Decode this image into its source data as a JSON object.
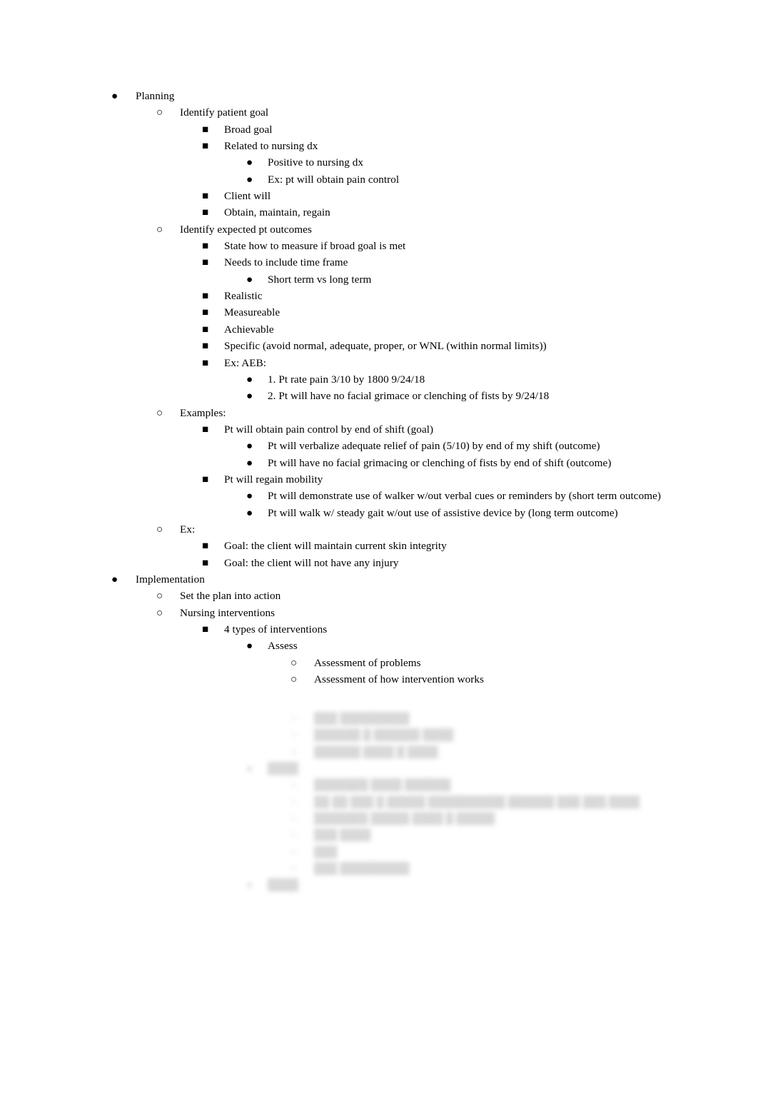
{
  "document": {
    "background_color": "#ffffff",
    "text_color": "#000000",
    "markers": {
      "disc": "●",
      "circle": "○",
      "square": "■"
    },
    "outline": [
      {
        "level": 1,
        "marker": "disc",
        "text": "Planning"
      },
      {
        "level": 2,
        "marker": "circle",
        "text": "Identify patient goal"
      },
      {
        "level": 3,
        "marker": "square",
        "text": "Broad goal"
      },
      {
        "level": 3,
        "marker": "square",
        "text": "Related to nursing dx"
      },
      {
        "level": 4,
        "marker": "disc",
        "text": "Positive to nursing dx"
      },
      {
        "level": 4,
        "marker": "disc",
        "text": "Ex: pt will obtain pain control"
      },
      {
        "level": 3,
        "marker": "square",
        "text": "Client will"
      },
      {
        "level": 3,
        "marker": "square",
        "text": "Obtain, maintain, regain"
      },
      {
        "level": 2,
        "marker": "circle",
        "text": "Identify expected pt outcomes"
      },
      {
        "level": 3,
        "marker": "square",
        "text": "State how to measure if broad goal is met"
      },
      {
        "level": 3,
        "marker": "square",
        "text": "Needs to include time frame"
      },
      {
        "level": 4,
        "marker": "disc",
        "text": "Short term vs long term"
      },
      {
        "level": 3,
        "marker": "square",
        "text": "Realistic"
      },
      {
        "level": 3,
        "marker": "square",
        "text": "Measureable"
      },
      {
        "level": 3,
        "marker": "square",
        "text": "Achievable"
      },
      {
        "level": 3,
        "marker": "square",
        "text": "Specific (avoid normal, adequate, proper, or WNL (within normal limits))"
      },
      {
        "level": 3,
        "marker": "square",
        "text": "Ex: AEB:"
      },
      {
        "level": 4,
        "marker": "disc",
        "text": "1. Pt rate pain 3/10 by 1800 9/24/18"
      },
      {
        "level": 4,
        "marker": "disc",
        "text": "2. Pt will have no facial grimace or clenching of fists by 9/24/18"
      },
      {
        "level": 2,
        "marker": "circle",
        "text": "Examples:"
      },
      {
        "level": 3,
        "marker": "square",
        "text": "Pt will obtain pain control by end of shift (goal)"
      },
      {
        "level": 4,
        "marker": "disc",
        "text": "Pt will verbalize adequate relief of pain (5/10) by end of my shift (outcome)"
      },
      {
        "level": 4,
        "marker": "disc",
        "text": "Pt will have no facial grimacing or clenching of fists by end of shift (outcome)"
      },
      {
        "level": 3,
        "marker": "square",
        "text": "Pt will regain mobility"
      },
      {
        "level": 4,
        "marker": "disc",
        "text": "Pt will demonstrate use of walker w/out verbal cues or reminders by (short term outcome)"
      },
      {
        "level": 4,
        "marker": "disc",
        "text": "Pt will walk w/ steady gait w/out use of assistive device by (long term outcome)"
      },
      {
        "level": 2,
        "marker": "circle",
        "text": "Ex:"
      },
      {
        "level": 3,
        "marker": "square",
        "text": "Goal: the client will maintain current skin integrity"
      },
      {
        "level": 3,
        "marker": "square",
        "text": "Goal: the client will not have any injury"
      },
      {
        "level": 1,
        "marker": "disc",
        "text": "Implementation"
      },
      {
        "level": 2,
        "marker": "circle",
        "text": "Set the plan into action"
      },
      {
        "level": 2,
        "marker": "circle",
        "text": "Nursing interventions"
      },
      {
        "level": 3,
        "marker": "square",
        "text": "4 types of interventions"
      },
      {
        "level": 4,
        "marker": "disc",
        "text": "Assess"
      },
      {
        "level": 5,
        "marker": "circle",
        "text": "Assessment of problems"
      },
      {
        "level": 5,
        "marker": "circle",
        "text": "Assessment of how intervention works"
      }
    ],
    "obscured_outline": [
      {
        "level": 5,
        "marker": "circle",
        "text": "███ █████████"
      },
      {
        "level": 5,
        "marker": "circle",
        "text": "██████ █ ██████ ████"
      },
      {
        "level": 5,
        "marker": "circle",
        "text": "██████ ████ █ ████"
      },
      {
        "level": 4,
        "marker": "disc",
        "text": "████"
      },
      {
        "level": 5,
        "marker": "circle",
        "text": "███████ ████ ██████"
      },
      {
        "level": 5,
        "marker": "circle",
        "text": "██ ██ ███ █ █████ ██████████ ██████ ███ ███ ████"
      },
      {
        "level": 5,
        "marker": "circle",
        "text": "███████ █████ ████ █ █████"
      },
      {
        "level": 5,
        "marker": "circle",
        "text": "███ ████"
      },
      {
        "level": 5,
        "marker": "circle",
        "text": "███"
      },
      {
        "level": 5,
        "marker": "circle",
        "text": "███ █████████"
      },
      {
        "level": 4,
        "marker": "disc",
        "text": "████"
      }
    ]
  }
}
